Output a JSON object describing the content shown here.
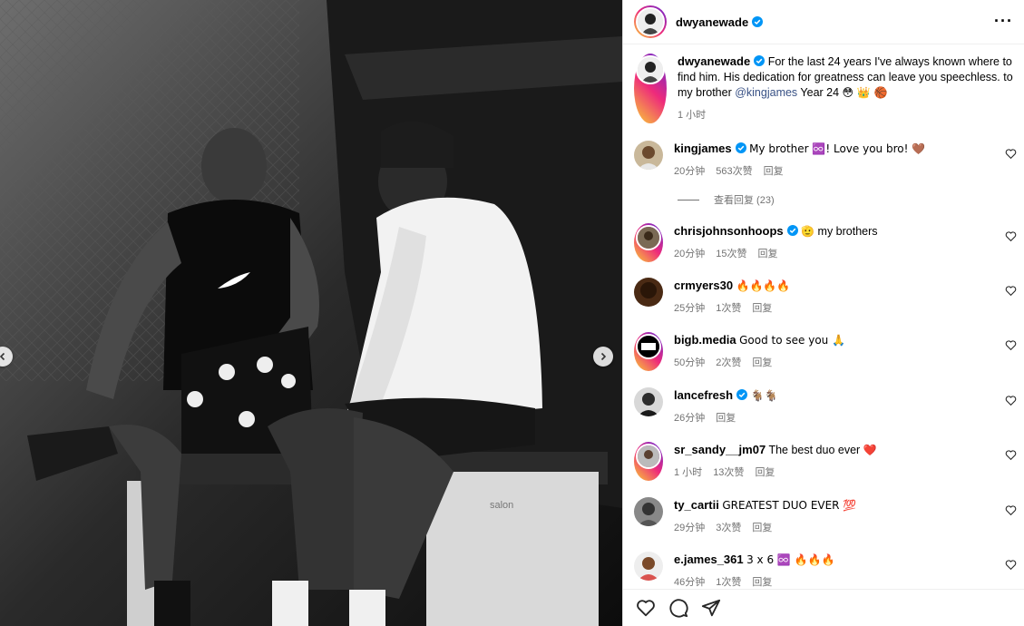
{
  "post": {
    "author": "dwyanewade",
    "more_label": "···"
  },
  "caption": {
    "author": "dwyanewade",
    "text_part1": "For the last 24 years I've always known where to find him. His dedication for greatness can leave you speechless. ",
    "glyph1": "",
    "text_part2": " to my brother ",
    "mention": "@kingjames",
    "text_part3": " Year 24 ",
    "emoji": "😳 👑 🏀",
    "time": "1 小时"
  },
  "comments": [
    {
      "user": "kingjames",
      "verified": true,
      "text": "My brother ♾️! Love you bro! 🤎",
      "tail": "",
      "time": "20分钟",
      "likes": "563次赞",
      "reply": "回复"
    },
    {
      "user": "chrisjohnsonhoops",
      "verified": true,
      "text": "🫡",
      "tail": " my brothers",
      "time": "20分钟",
      "likes": "15次赞",
      "reply": "回复"
    },
    {
      "user": "crmyers30",
      "verified": false,
      "text": "🔥🔥🔥🔥",
      "tail": "",
      "time": "25分钟",
      "likes": "1次赞",
      "reply": "回复"
    },
    {
      "user": "bigb.media",
      "verified": false,
      "text": "Good to see you 🙏",
      "tail": "",
      "time": "50分钟",
      "likes": "2次赞",
      "reply": "回复"
    },
    {
      "user": "lancefresh",
      "verified": true,
      "text": "🐐🐐",
      "tail": "",
      "time": "26分钟",
      "likes": "",
      "reply": "回复"
    },
    {
      "user": "sr_sandy__jm07",
      "verified": false,
      "text": "The best duo ever ",
      "tail": "❤️",
      "time": "1 小时",
      "likes": "13次赞",
      "reply": "回复"
    },
    {
      "user": "ty_cartii",
      "verified": false,
      "text": "GREATEST DUO EVER 💯",
      "tail": "",
      "time": "29分钟",
      "likes": "3次赞",
      "reply": "回复"
    },
    {
      "user": "e.james_361",
      "verified": false,
      "text": "3 x 6 ♾️ 🔥🔥🔥",
      "tail": "",
      "time": "46分钟",
      "likes": "1次赞",
      "reply": "回复"
    }
  ],
  "view_replies": "查看回复 (23)",
  "photo": {
    "brand_text": "salon"
  },
  "colors": {
    "verified": "#0095f6",
    "meta": "#737373",
    "link": "#385185"
  }
}
